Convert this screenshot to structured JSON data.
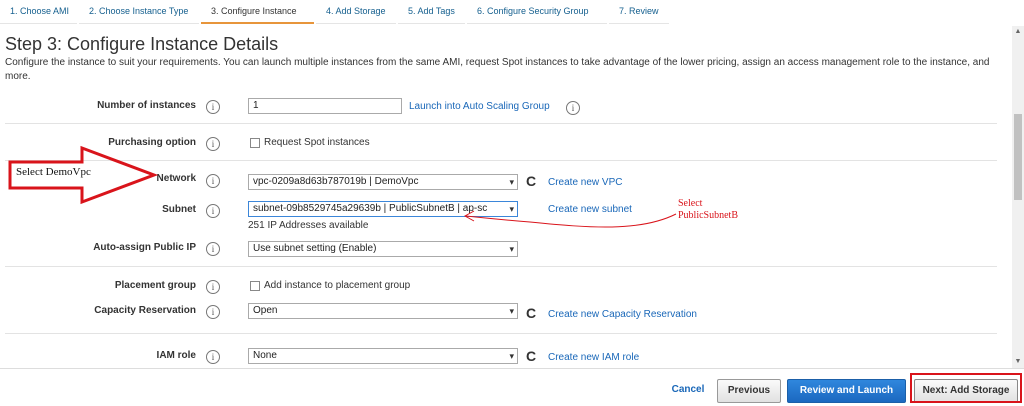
{
  "tabs": [
    {
      "label": "1. Choose AMI"
    },
    {
      "label": "2. Choose Instance Type"
    },
    {
      "label": "3. Configure Instance"
    },
    {
      "label": "4. Add Storage"
    },
    {
      "label": "5. Add Tags"
    },
    {
      "label": "6. Configure Security Group"
    },
    {
      "label": "7. Review"
    }
  ],
  "header": {
    "title": "Step 3: Configure Instance Details",
    "description": "Configure the instance to suit your requirements. You can launch multiple instances from the same AMI, request Spot instances to take advantage of the lower pricing, assign an access management role to the instance, and more."
  },
  "form": {
    "number_of_instances": {
      "label": "Number of instances",
      "value": "1",
      "link": "Launch into Auto Scaling Group"
    },
    "purchasing_option": {
      "label": "Purchasing option",
      "checkbox_label": "Request Spot instances"
    },
    "network": {
      "label": "Network",
      "value": "vpc-0209a8d63b787019b | DemoVpc",
      "link": "Create new VPC"
    },
    "subnet": {
      "label": "Subnet",
      "value": "subnet-09b8529745a29639b | PublicSubnetB | ap-sc",
      "link": "Create new subnet",
      "note": "251 IP Addresses available"
    },
    "auto_assign_ip": {
      "label": "Auto-assign Public IP",
      "value": "Use subnet setting (Enable)"
    },
    "placement_group": {
      "label": "Placement group",
      "checkbox_label": "Add instance to placement group"
    },
    "capacity_reservation": {
      "label": "Capacity Reservation",
      "value": "Open",
      "link": "Create new Capacity Reservation"
    },
    "iam_role": {
      "label": "IAM role",
      "value": "None",
      "link": "Create new IAM role"
    }
  },
  "info_glyph": "i",
  "refresh_glyph": "C",
  "scroll": {
    "up": "▲",
    "down": "▼"
  },
  "footer": {
    "cancel": "Cancel",
    "previous": "Previous",
    "review_launch": "Review and Launch",
    "next": "Next: Add Storage"
  },
  "annotations": {
    "network_note": "Select DemoVpc",
    "subnet_note_line1": "Select",
    "subnet_note_line2": "PublicSubnetB"
  },
  "colors": {
    "accent": "#e7953b",
    "link": "#1967b8",
    "primary": "#1b68c0",
    "annotation": "#d9141b"
  }
}
